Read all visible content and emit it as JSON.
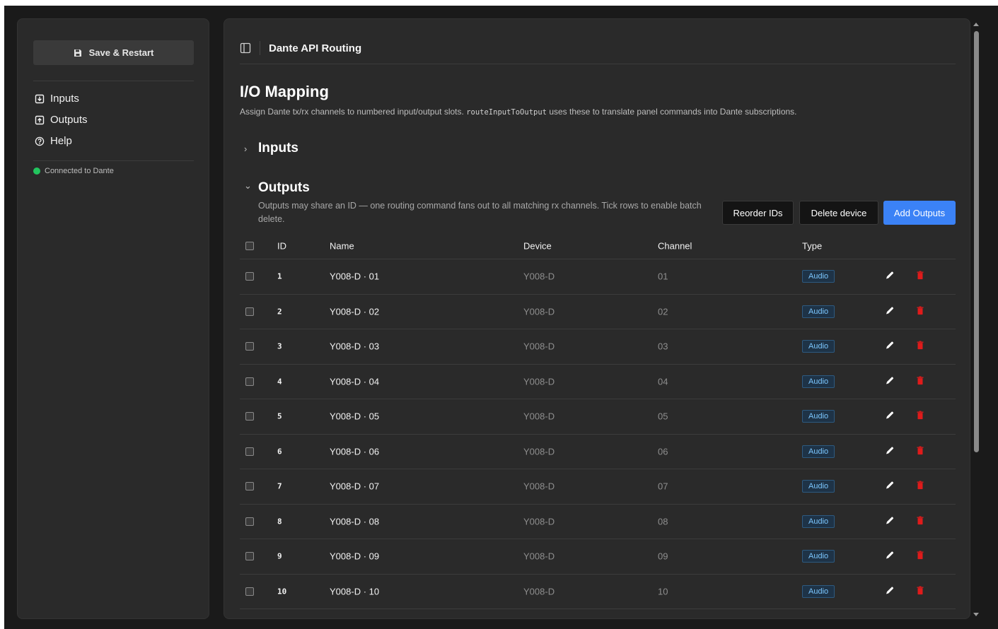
{
  "sidebar": {
    "save_label": "Save & Restart",
    "nav": [
      {
        "label": "Inputs",
        "icon": "box-arrow-in-icon"
      },
      {
        "label": "Outputs",
        "icon": "box-arrow-out-icon"
      },
      {
        "label": "Help",
        "icon": "question-circle-icon"
      }
    ],
    "status": "Connected to Dante",
    "status_color": "#22c55e"
  },
  "header": {
    "title": "Dante API Routing"
  },
  "page": {
    "title": "I/O Mapping",
    "desc_before": "Assign Dante tx/rx channels to numbered input/output slots. ",
    "desc_code": "routeInputToOutput",
    "desc_after": " uses these to translate panel commands into Dante subscriptions."
  },
  "inputs_section": {
    "label": "Inputs",
    "chevron": "›"
  },
  "outputs_section": {
    "label": "Outputs",
    "chevron": "⌄",
    "description": "Outputs may share an ID — one routing command fans out to all matching rx channels. Tick rows to enable batch delete.",
    "reorder_label": "Reorder IDs",
    "delete_device_label": "Delete device",
    "add_label": "Add Outputs",
    "accent": "#3b82f6"
  },
  "table": {
    "headers": {
      "id": "ID",
      "name": "Name",
      "device": "Device",
      "channel": "Channel",
      "type": "Type"
    },
    "rows": [
      {
        "id": "1",
        "name": "Y008-D · 01",
        "device": "Y008-D",
        "channel": "01",
        "type": "Audio"
      },
      {
        "id": "2",
        "name": "Y008-D · 02",
        "device": "Y008-D",
        "channel": "02",
        "type": "Audio"
      },
      {
        "id": "3",
        "name": "Y008-D · 03",
        "device": "Y008-D",
        "channel": "03",
        "type": "Audio"
      },
      {
        "id": "4",
        "name": "Y008-D · 04",
        "device": "Y008-D",
        "channel": "04",
        "type": "Audio"
      },
      {
        "id": "5",
        "name": "Y008-D · 05",
        "device": "Y008-D",
        "channel": "05",
        "type": "Audio"
      },
      {
        "id": "6",
        "name": "Y008-D · 06",
        "device": "Y008-D",
        "channel": "06",
        "type": "Audio"
      },
      {
        "id": "7",
        "name": "Y008-D · 07",
        "device": "Y008-D",
        "channel": "07",
        "type": "Audio"
      },
      {
        "id": "8",
        "name": "Y008-D · 08",
        "device": "Y008-D",
        "channel": "08",
        "type": "Audio"
      },
      {
        "id": "9",
        "name": "Y008-D · 09",
        "device": "Y008-D",
        "channel": "09",
        "type": "Audio"
      },
      {
        "id": "10",
        "name": "Y008-D · 10",
        "device": "Y008-D",
        "channel": "10",
        "type": "Audio"
      }
    ],
    "delete_color": "#e01b1b"
  }
}
